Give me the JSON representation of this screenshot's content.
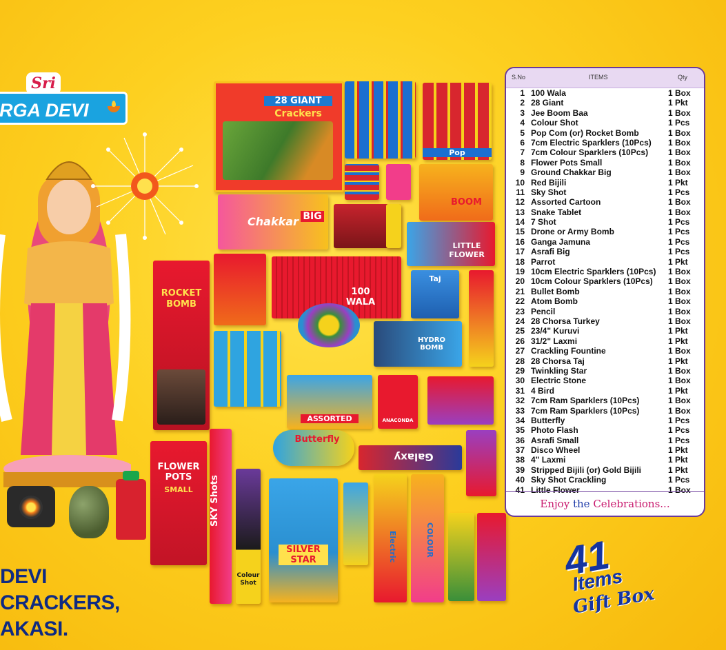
{
  "brand": {
    "prefix": "Sri",
    "name": "RGA DEVI"
  },
  "company": {
    "line1": "DEVI CRACKERS,",
    "line2": "AKASI."
  },
  "products": {
    "giant_title": "28 GIANT",
    "giant_sub": "Crackers",
    "chakkar": "Chakkar",
    "chakkar_big": "BIG",
    "rocket_bomb": "ROCKET BOMB",
    "wala": "100 WALA",
    "flower_pots": "FLOWER POTS",
    "flower_pots_small": "SMALL",
    "sky_shots": "SKY Shots",
    "colour_shot": "Colour Shot",
    "silver_star": "SILVER STAR",
    "butterfly": "Butterfly",
    "galaxy": "Galaxy",
    "hydro_bomb": "HYDRO BOMB",
    "little_flower": "LITTLE FLOWER",
    "boom": "BOOM",
    "assorted": "ASSORTED",
    "anaconda": "ANACONDA",
    "taj": "Taj",
    "colour": "COLOUR",
    "electric": "Electric",
    "pop": "Pop"
  },
  "table": {
    "headers": {
      "sno": "S.No",
      "items": "ITEMS",
      "qty": "Qty"
    },
    "rows": [
      {
        "n": "1",
        "item": "100 Wala",
        "qty": "1 Box"
      },
      {
        "n": "2",
        "item": "28 Giant",
        "qty": "1 Pkt"
      },
      {
        "n": "3",
        "item": "Jee Boom Baa",
        "qty": "1 Box"
      },
      {
        "n": "4",
        "item": "Colour Shot",
        "qty": "1 Pcs"
      },
      {
        "n": "5",
        "item": "Pop Com (or) Rocket Bomb",
        "qty": "1 Box"
      },
      {
        "n": "6",
        "item": "7cm Electric Sparklers (10Pcs)",
        "qty": "1 Box"
      },
      {
        "n": "7",
        "item": "7cm Colour Sparklers (10Pcs)",
        "qty": "1 Box"
      },
      {
        "n": "8",
        "item": "Flower Pots Small",
        "qty": "1 Box"
      },
      {
        "n": "9",
        "item": "Ground Chakkar Big",
        "qty": "1 Box"
      },
      {
        "n": "10",
        "item": "Red Bijili",
        "qty": "1 Pkt"
      },
      {
        "n": "11",
        "item": "Sky Shot",
        "qty": "1 Pcs"
      },
      {
        "n": "12",
        "item": "Assorted Cartoon",
        "qty": "1 Box"
      },
      {
        "n": "13",
        "item": "Snake Tablet",
        "qty": "1 Box"
      },
      {
        "n": "14",
        "item": "7 Shot",
        "qty": "1 Pcs"
      },
      {
        "n": "15",
        "item": "Drone or Army Bomb",
        "qty": "1 Pcs"
      },
      {
        "n": "16",
        "item": "Ganga Jamuna",
        "qty": "1 Pcs"
      },
      {
        "n": "17",
        "item": "Asrafi Big",
        "qty": "1 Pcs"
      },
      {
        "n": "18",
        "item": "Parrot",
        "qty": "1 Pkt"
      },
      {
        "n": "19",
        "item": "10cm Electric Sparklers (10Pcs)",
        "qty": "1 Box"
      },
      {
        "n": "20",
        "item": "10cm Colour Sparklers (10Pcs)",
        "qty": "1 Box"
      },
      {
        "n": "21",
        "item": "Bullet Bomb",
        "qty": "1 Box"
      },
      {
        "n": "22",
        "item": "Atom Bomb",
        "qty": "1 Box"
      },
      {
        "n": "23",
        "item": "Pencil",
        "qty": "1 Box"
      },
      {
        "n": "24",
        "item": "28 Chorsa Turkey",
        "qty": "1 Box"
      },
      {
        "n": "25",
        "item": "23/4\" Kuruvi",
        "qty": "1 Pkt"
      },
      {
        "n": "26",
        "item": "31/2\" Laxmi",
        "qty": "1 Pkt"
      },
      {
        "n": "27",
        "item": "Crackling Fountine",
        "qty": "1 Box"
      },
      {
        "n": "28",
        "item": "28 Chorsa Taj",
        "qty": "1 Pkt"
      },
      {
        "n": "29",
        "item": "Twinkling Star",
        "qty": "1 Box"
      },
      {
        "n": "30",
        "item": "Electric Stone",
        "qty": "1 Box"
      },
      {
        "n": "31",
        "item": "4 Bird",
        "qty": "1 Pkt"
      },
      {
        "n": "32",
        "item": "7cm Ram Sparklers (10Pcs)",
        "qty": "1 Box"
      },
      {
        "n": "33",
        "item": "7cm Ram Sparklers (10Pcs)",
        "qty": "1 Box"
      },
      {
        "n": "34",
        "item": "Butterfly",
        "qty": "1 Pcs"
      },
      {
        "n": "35",
        "item": "Photo Flash",
        "qty": "1 Pcs"
      },
      {
        "n": "36",
        "item": "Asrafi Small",
        "qty": "1 Pcs"
      },
      {
        "n": "37",
        "item": "Disco Wheel",
        "qty": "1 Pkt"
      },
      {
        "n": "38",
        "item": "4\" Laxmi",
        "qty": "1 Pkt"
      },
      {
        "n": "39",
        "item": "Stripped Bijili (or) Gold Bijili",
        "qty": "1 Pkt"
      },
      {
        "n": "40",
        "item": "Sky Shot Crackling",
        "qty": "1 Pcs"
      },
      {
        "n": "41",
        "item": "Little Flower",
        "qty": "1 Box"
      }
    ],
    "footer": {
      "w1": "Enjoy",
      "w2": "the",
      "w3": "Celebrations..."
    }
  },
  "gift_box": {
    "count": "41",
    "items": "Items",
    "label": "Gift Box"
  },
  "colors": {
    "background": "#fdd020",
    "panel_border": "#6a3a9a",
    "heading": "#1534a0"
  }
}
